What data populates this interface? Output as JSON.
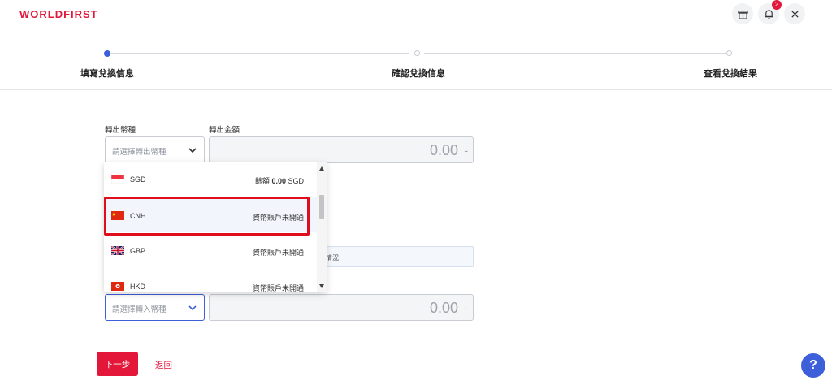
{
  "header": {
    "logo": "WORLDFIRST",
    "notification_count": "2",
    "icons": [
      "gift-icon",
      "bell-icon",
      "close-icon"
    ]
  },
  "steps": [
    {
      "label": "填寫兌換信息",
      "state": "active"
    },
    {
      "label": "確認兌換信息",
      "state": "pending"
    },
    {
      "label": "查看兌換結果",
      "state": "pending"
    }
  ],
  "form": {
    "out_currency_label": "轉出幣種",
    "out_amount_label": "轉出金額",
    "out_currency_placeholder": "請選擇轉出幣種",
    "out_amount_value": "0.00",
    "out_amount_suffix": "-",
    "info_partial": "情況",
    "in_currency_placeholder": "請選擇轉入幣種",
    "in_amount_value": "0.00",
    "in_amount_suffix": "-"
  },
  "dropdown": {
    "options": [
      {
        "code": "SGD",
        "flag": "sg-flag-icon",
        "right_prefix": "餘額",
        "right_amount": "0.00",
        "right_suffix": "SGD"
      },
      {
        "code": "CNH",
        "flag": "cn-flag-icon",
        "right_text": "資幣賬戶未開通",
        "highlighted": true
      },
      {
        "code": "GBP",
        "flag": "gb-flag-icon",
        "right_text": "資幣賬戶未開通"
      },
      {
        "code": "HKD",
        "flag": "hk-flag-icon",
        "right_text": "資幣賬戶未開通"
      }
    ]
  },
  "actions": {
    "next_label": "下一步",
    "back_label": "返回"
  },
  "help": {
    "label": "?"
  },
  "colors": {
    "brand": "#e2173a",
    "accent": "#3d5fd9",
    "highlight": "#e00d1e"
  }
}
